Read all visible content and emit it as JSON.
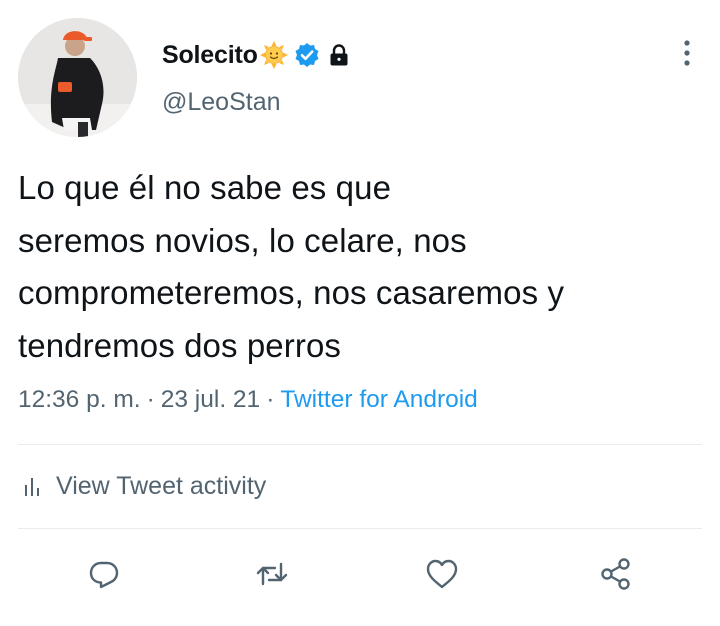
{
  "user": {
    "display_name": "Solecito",
    "handle": "@LeoStan",
    "name_emoji": "sun-face-emoji",
    "verified_icon": "verified-badge-icon",
    "protected_icon": "lock-icon"
  },
  "tweet": {
    "text": "Lo que él no sabe es que\nseremos novios, lo celare, nos\ncomprometeremos, nos casaremos y\ntendremos dos perros",
    "time": "12:36 p. m.",
    "date": "23 jul. 21",
    "separator": "·",
    "source": "Twitter for Android"
  },
  "activity": {
    "label": "View Tweet activity",
    "icon": "bar-chart-icon"
  },
  "actions": [
    {
      "name": "reply",
      "icon": "reply-icon"
    },
    {
      "name": "retweet",
      "icon": "retweet-icon"
    },
    {
      "name": "like",
      "icon": "heart-icon"
    },
    {
      "name": "share",
      "icon": "share-icon"
    }
  ],
  "colors": {
    "text_primary": "#0f1419",
    "text_secondary": "#536471",
    "accent": "#1d9bf0",
    "verified": "#1d9bf0",
    "divider": "#e6ecf0"
  }
}
